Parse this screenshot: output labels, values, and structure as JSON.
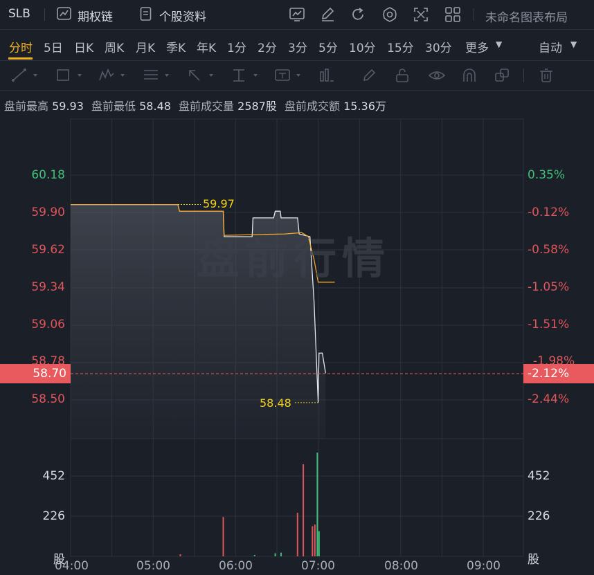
{
  "header": {
    "symbol": "SLB",
    "options_chain_label": "期权链",
    "profile_label": "个股资料",
    "layout_label": "未命名图表布局",
    "icons": [
      "options-chain-icon",
      "document-icon",
      "chart-icon",
      "edit-icon",
      "refresh-icon",
      "settings-icon",
      "fullscreen-icon",
      "grid-layout-icon"
    ]
  },
  "periods": {
    "items": [
      "分时",
      "5日",
      "日K",
      "周K",
      "月K",
      "季K",
      "年K",
      "1分",
      "2分",
      "3分",
      "5分",
      "10分",
      "15分",
      "30分"
    ],
    "more_label": "更多",
    "active": "分时",
    "auto_label": "自动"
  },
  "tools": [
    "line-tool-icon",
    "rectangle-tool-icon",
    "wave-tool-icon",
    "fib-tool-icon",
    "arrow-tool-icon",
    "measure-tool-icon",
    "text-tool-icon",
    "indicator-tool-icon",
    "pen-tool-icon",
    "lock-icon",
    "eye-icon",
    "magnet-icon",
    "copy-icon",
    "trash-icon"
  ],
  "premarket": {
    "high_label": "盘前最高",
    "high": "59.93",
    "low_label": "盘前最低",
    "low": "58.48",
    "volume_label": "盘前成交量",
    "volume": "2587股",
    "amount_label": "盘前成交额",
    "amount": "15.36万"
  },
  "watermark": "盘前行情",
  "chart_data": {
    "type": "line",
    "price_ticks": [
      "60.18",
      "59.90",
      "59.62",
      "59.34",
      "59.06",
      "58.78",
      "58.50"
    ],
    "pct_ticks": [
      "0.35%",
      "-0.12%",
      "-0.58%",
      "-1.05%",
      "-1.51%",
      "-1.98%",
      "-2.44%"
    ],
    "current_price": "58.70",
    "current_pct": "-2.12%",
    "high_annotation": "59.97",
    "low_annotation": "58.48",
    "volume_ticks": [
      "452",
      "226"
    ],
    "volume_unit": "股",
    "x_ticks": [
      "04:00",
      "05:00",
      "06:00",
      "07:00",
      "08:00",
      "09:00"
    ],
    "price_series": [
      [
        0,
        59.96
      ],
      [
        1.3,
        59.96
      ],
      [
        1.32,
        59.91
      ],
      [
        1.85,
        59.91
      ],
      [
        1.86,
        59.72
      ],
      [
        2.2,
        59.72
      ],
      [
        2.21,
        59.86
      ],
      [
        2.46,
        59.86
      ],
      [
        2.48,
        59.91
      ],
      [
        2.54,
        59.91
      ],
      [
        2.55,
        59.86
      ],
      [
        2.75,
        59.86
      ],
      [
        2.77,
        59.74
      ],
      [
        2.9,
        59.72
      ],
      [
        2.95,
        59.24
      ],
      [
        3.0,
        58.48
      ],
      [
        3.01,
        58.85
      ],
      [
        3.05,
        58.85
      ],
      [
        3.09,
        58.7
      ]
    ],
    "avg_series": [
      [
        0,
        59.96
      ],
      [
        1.3,
        59.96
      ],
      [
        1.32,
        59.91
      ],
      [
        1.85,
        59.91
      ],
      [
        1.86,
        59.73
      ],
      [
        2.6,
        59.74
      ],
      [
        2.8,
        59.75
      ],
      [
        2.88,
        59.72
      ],
      [
        2.95,
        59.55
      ],
      [
        3.0,
        59.38
      ],
      [
        3.2,
        59.38
      ]
    ],
    "volume_bars": [
      [
        1.33,
        12,
        "red"
      ],
      [
        1.85,
        235,
        "red"
      ],
      [
        2.23,
        8,
        "green"
      ],
      [
        2.48,
        18,
        "green"
      ],
      [
        2.55,
        22,
        "green"
      ],
      [
        2.75,
        260,
        "red"
      ],
      [
        2.82,
        550,
        "red"
      ],
      [
        2.93,
        180,
        "red"
      ],
      [
        2.96,
        190,
        "red"
      ],
      [
        2.99,
        620,
        "green"
      ],
      [
        3.01,
        150,
        "green"
      ]
    ],
    "volume_max": 670
  }
}
